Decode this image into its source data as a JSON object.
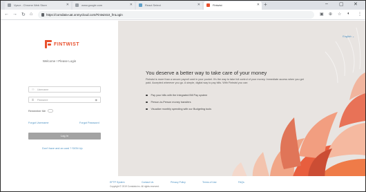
{
  "browser": {
    "tabs": [
      {
        "label": "Vysor - Chrome Web Store",
        "active": false
      },
      {
        "label": "www.google.com",
        "active": false
      },
      {
        "label": "React Select",
        "active": false
      },
      {
        "label": "Fintwist",
        "active": true
      }
    ],
    "new_tab_glyph": "+",
    "window_controls": {
      "minimize": "–",
      "maximize": "▢",
      "close": "✕"
    },
    "url": "https://comdata-uat.onmycloud.com/FintwistUI_fmLogin"
  },
  "login": {
    "brand": "FINTWIST",
    "welcome": "Welcome ! Please Login",
    "username_placeholder": "Username",
    "password_placeholder": "Password",
    "remember_label": "Remember Me",
    "forgot_username": "Forgot Username",
    "forgot_password": "Forgot Password",
    "login_button": "Log In",
    "signup_link": "Don't have and an card ? SIGN Up"
  },
  "hero": {
    "language": "English",
    "headline": "You deserve a better way to take care of your money",
    "intro": "Fintwist is more than a secure payroll card in your pocket. It's the way to take full control of your money. Immediate access when you get paid. Accepted wherever you go. A simple, digital way to pay bills. With Fintwist you can:",
    "bullets": [
      "Pay your bills with the Integrated Bill Pay system",
      "Person-to-Person money transfers",
      "Visualize monthly spending with our Budgeting tools"
    ]
  },
  "footer": {
    "links": [
      "EFTP System",
      "Contact Us",
      "Privacy Policy",
      "Terms of Use",
      "FAQs"
    ],
    "copyright": "Copyright © 2019 Comdata Inc. All rights reserved."
  },
  "colors": {
    "brand": "#e8502d",
    "link": "#4a90c2",
    "hero_bg": "#e8e4e1",
    "button": "#a3a3a3"
  }
}
